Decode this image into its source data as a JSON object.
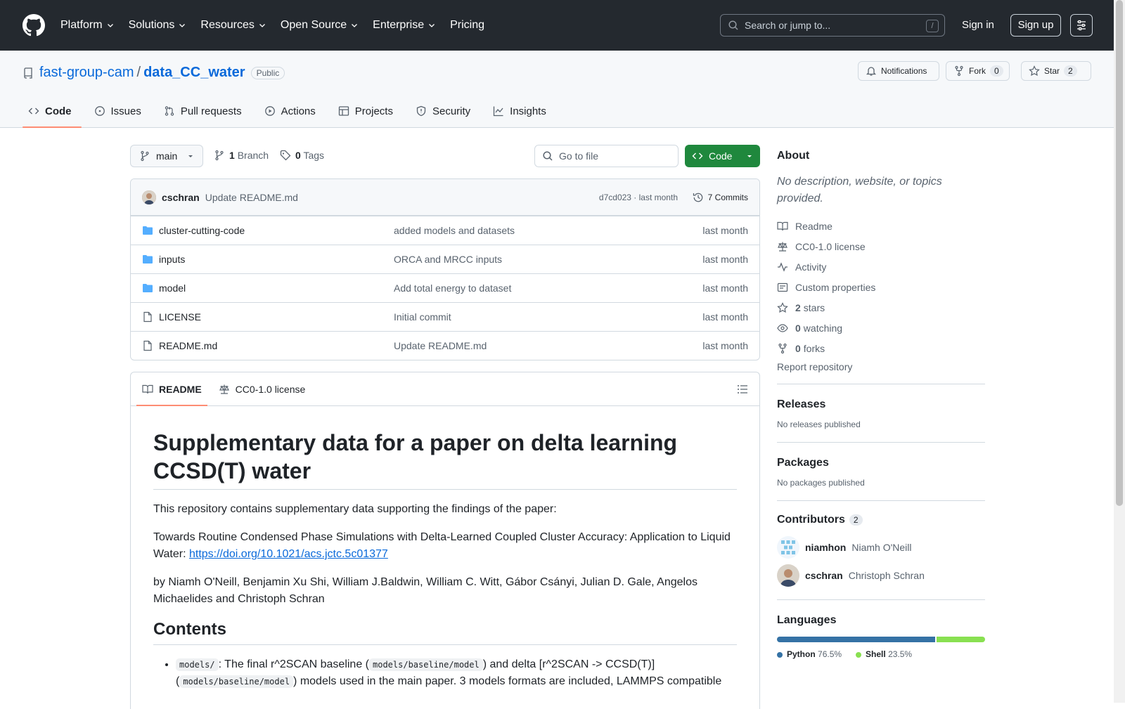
{
  "header": {
    "nav": [
      "Platform",
      "Solutions",
      "Resources",
      "Open Source",
      "Enterprise",
      "Pricing"
    ],
    "search_placeholder": "Search or jump to...",
    "search_shortcut": "/",
    "signin": "Sign in",
    "signup": "Sign up"
  },
  "repo": {
    "owner": "fast-group-cam",
    "separator": "/",
    "name": "data_CC_water",
    "visibility": "Public",
    "notifications": "Notifications",
    "fork_label": "Fork",
    "fork_count": "0",
    "star_label": "Star",
    "star_count": "2",
    "tabs": [
      "Code",
      "Issues",
      "Pull requests",
      "Actions",
      "Projects",
      "Security",
      "Insights"
    ]
  },
  "toolbar": {
    "branch": "main",
    "branch_count": "1",
    "branch_label": "Branch",
    "tag_count": "0",
    "tag_label": "Tags",
    "go_to_file": "Go to file",
    "code_button": "Code"
  },
  "commit": {
    "author": "cschran",
    "message": "Update README.md",
    "hash_time": "d7cd023 · last month",
    "commits": "7 Commits"
  },
  "files": [
    {
      "name": "cluster-cutting-code",
      "type": "folder",
      "message": "added models and datasets",
      "age": "last month"
    },
    {
      "name": "inputs",
      "type": "folder",
      "message": "ORCA and MRCC inputs",
      "age": "last month"
    },
    {
      "name": "model",
      "type": "folder",
      "message": "Add total energy to dataset",
      "age": "last month"
    },
    {
      "name": "LICENSE",
      "type": "file",
      "message": "Initial commit",
      "age": "last month"
    },
    {
      "name": "README.md",
      "type": "file",
      "message": "Update README.md",
      "age": "last month"
    }
  ],
  "readme": {
    "tab_readme": "README",
    "tab_license": "CC0-1.0 license",
    "title": "Supplementary data for a paper on delta learning CCSD(T) water",
    "p1": "This repository contains supplementary data supporting the findings of the paper:",
    "p2_text": "Towards Routine Condensed Phase Simulations with Delta-Learned Coupled Cluster Accuracy: Application to Liquid Water: ",
    "p2_link": "https://doi.org/10.1021/acs.jctc.5c01377",
    "p3": "by Niamh O'Neill, Benjamin Xu Shi, William J.Baldwin, William C. Witt, Gábor Csányi, Julian D. Gale, Angelos Michaelides and Christoph Schran",
    "contents_heading": "Contents",
    "li_code1": "models/",
    "li_text1": ": The final r^2SCAN baseline (",
    "li_code2": "models/baseline/model",
    "li_text2": ") and delta [r^2SCAN -> CCSD(T)] (",
    "li_code3": "models/baseline/model",
    "li_text3": ") models used in the main paper. 3 models formats are included, LAMMPS compatible"
  },
  "sidebar": {
    "about": "About",
    "description": "No description, website, or topics provided.",
    "items": [
      {
        "icon": "book-icon",
        "label": "Readme"
      },
      {
        "icon": "law-icon",
        "label": "CC0-1.0 license"
      },
      {
        "icon": "pulse-icon",
        "label": "Activity"
      },
      {
        "icon": "note-icon",
        "label": "Custom properties"
      }
    ],
    "stars_count": "2",
    "stars_label": "stars",
    "watching_count": "0",
    "watching_label": "watching",
    "forks_count": "0",
    "forks_label": "forks",
    "report": "Report repository",
    "releases": "Releases",
    "releases_none": "No releases published",
    "packages": "Packages",
    "packages_none": "No packages published",
    "contributors": "Contributors",
    "contributors_count": "2",
    "contributor_list": [
      {
        "login": "niamhon",
        "name": "Niamh O'Neill"
      },
      {
        "login": "cschran",
        "name": "Christoph Schran"
      }
    ],
    "languages": "Languages",
    "language_list": [
      {
        "name": "Python",
        "percent": "76.5%",
        "value": 76.5,
        "color": "#3572A5"
      },
      {
        "name": "Shell",
        "percent": "23.5%",
        "value": 23.5,
        "color": "#89e051"
      }
    ]
  }
}
